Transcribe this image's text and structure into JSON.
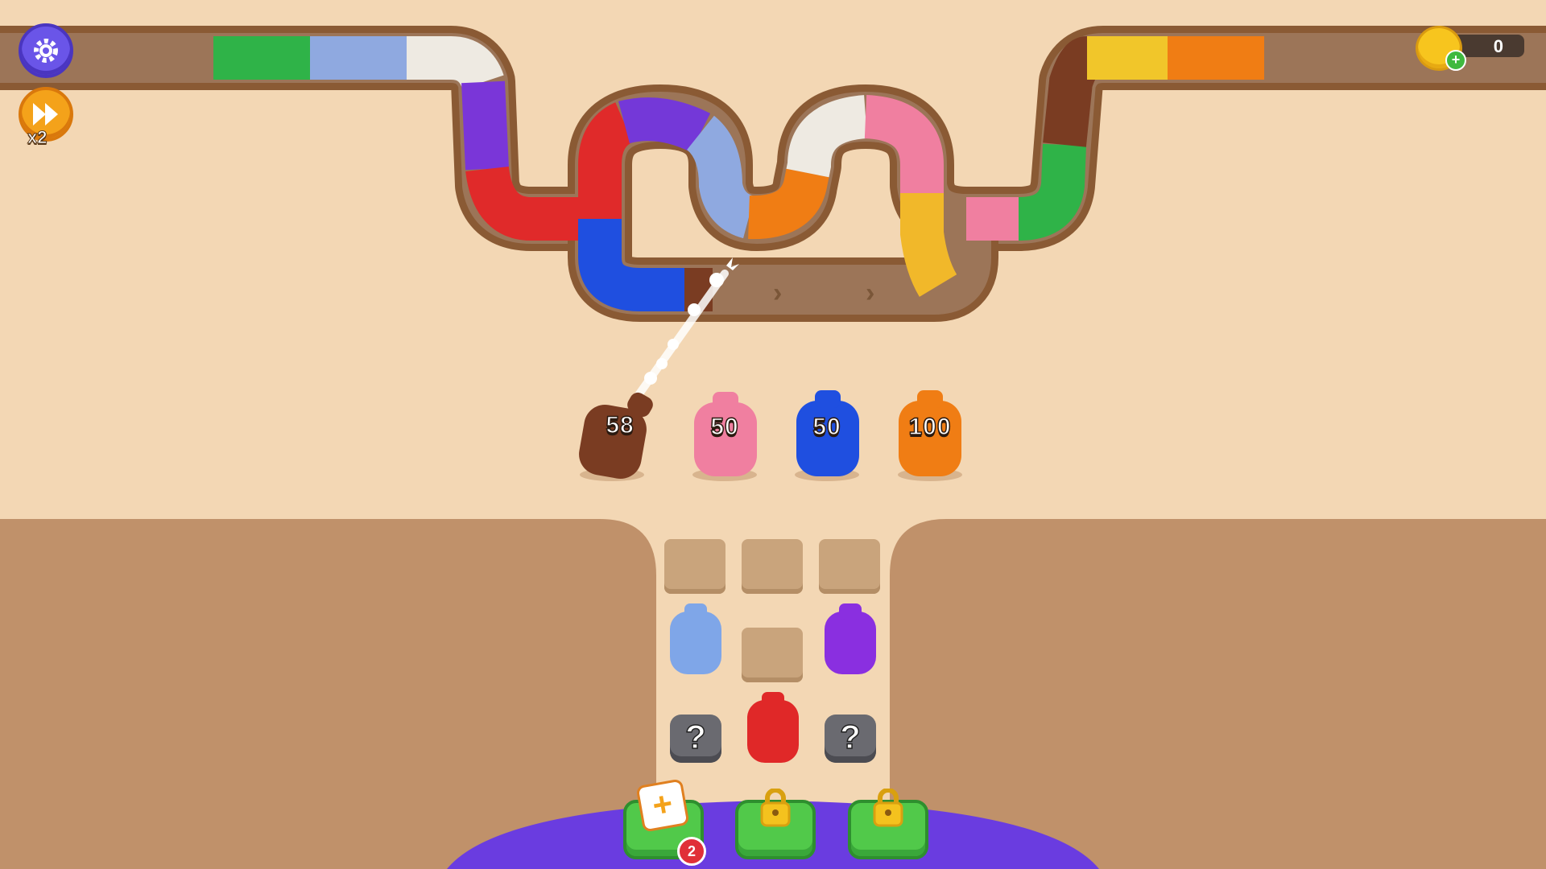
{
  "hud": {
    "settings_icon": "gear-icon",
    "speed_icon": "fast-forward-icon",
    "speed_label": "x2",
    "coins": "0",
    "coin_plus": "+"
  },
  "shooters": [
    {
      "color": "#7a3c22",
      "count": "58"
    },
    {
      "color": "#f07fa0",
      "count": "50"
    },
    {
      "color": "#1f4fe0",
      "count": "50"
    },
    {
      "color": "#f07d14",
      "count": "100"
    }
  ],
  "grid": {
    "rows": [
      [
        "empty",
        "empty",
        "empty"
      ],
      [
        "#7fa6e8",
        "empty",
        "#8a2fe0"
      ],
      [
        "hidden",
        "#e02828",
        "hidden"
      ]
    ],
    "hidden_glyph": "?"
  },
  "bottom_bar": {
    "add_slot_icon": "plus-card-icon",
    "add_slot_count": "2",
    "locked_icon": "lock-icon"
  },
  "colors": {
    "background": "#f3d7b4",
    "track_border": "#8a5a34",
    "track_floor": "#9c7558",
    "panel": "#bf8f66",
    "bottom_panel": "#6a3ce0"
  }
}
